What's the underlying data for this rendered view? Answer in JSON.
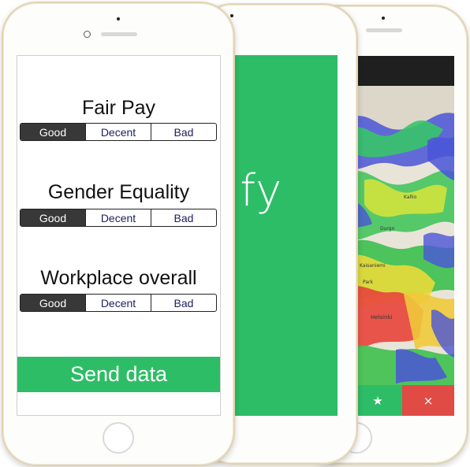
{
  "colors": {
    "accent_green": "#2dbd66",
    "segment_selected": "#383838",
    "segment_text": "#1b1f5e",
    "tab_orange": "#e8902a",
    "tab_red": "#e14b45"
  },
  "survey": {
    "questions": [
      {
        "title": "Fair Pay",
        "options": [
          "Good",
          "Decent",
          "Bad"
        ],
        "selected": "Good"
      },
      {
        "title": "Gender Equality",
        "options": [
          "Good",
          "Decent",
          "Bad"
        ],
        "selected": "Good"
      },
      {
        "title": "Workplace overall",
        "options": [
          "Good",
          "Decent",
          "Bad"
        ],
        "selected": "Good"
      }
    ],
    "send_label": "Send data"
  },
  "splash": {
    "text": "alify"
  },
  "map": {
    "labels": {
      "helsinki": "Helsinki",
      "kaisaniemi": "Kaisaniemi",
      "park": "Park",
      "kallio": "Kallio",
      "durgo": "Durgo"
    },
    "tabs": [
      {
        "icon": "star-icon",
        "glyph": "★"
      },
      {
        "icon": "close-icon",
        "glyph": "×"
      }
    ]
  }
}
